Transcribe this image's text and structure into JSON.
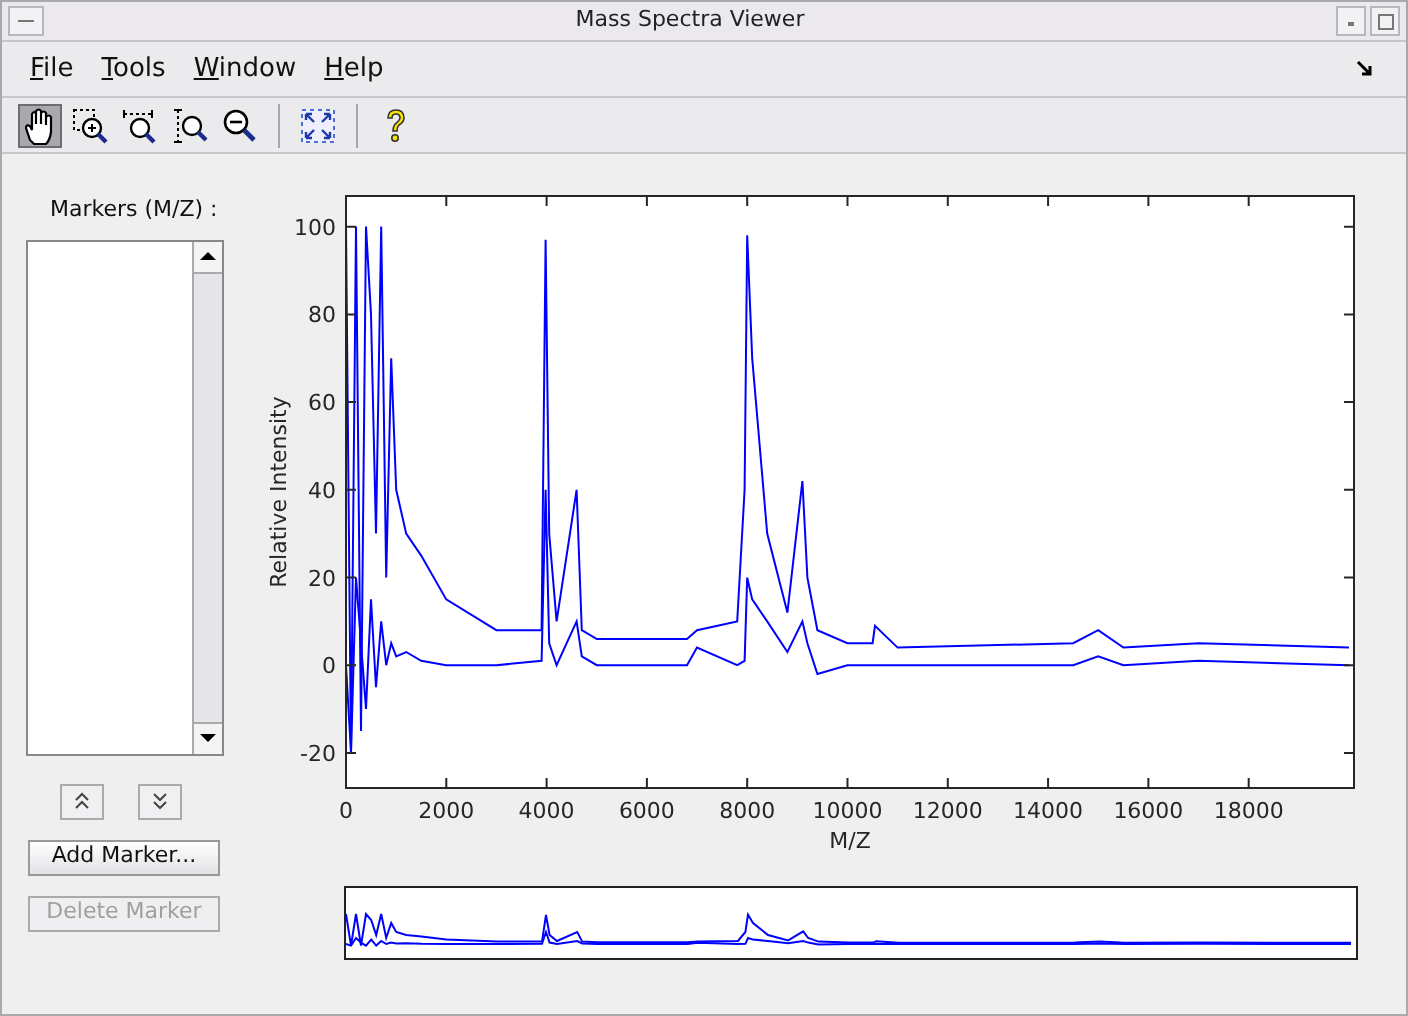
{
  "window": {
    "title": "Mass Spectra Viewer"
  },
  "menu": [
    {
      "label": "File"
    },
    {
      "label": "Tools"
    },
    {
      "label": "Window"
    },
    {
      "label": "Help"
    }
  ],
  "toolbar": [
    {
      "kind": "pan",
      "selected": true
    },
    {
      "kind": "zoom-xy",
      "selected": false
    },
    {
      "kind": "zoom-x",
      "selected": false
    },
    {
      "kind": "zoom-y",
      "selected": false
    },
    {
      "kind": "zoom-out",
      "selected": false
    },
    {
      "kind": "separator"
    },
    {
      "kind": "reset-view",
      "selected": false
    },
    {
      "kind": "separator"
    },
    {
      "kind": "help",
      "selected": false
    }
  ],
  "markers_panel": {
    "label": "Markers (M/Z) :",
    "buttons": [
      {
        "label": "Add Marker...",
        "disabled": false
      },
      {
        "label": "Delete Marker",
        "disabled": true
      }
    ]
  },
  "plot": {
    "chart_data": {
      "type": "line",
      "xlabel": "M/Z",
      "ylabel": "Relative Intensity",
      "xlim": [
        0,
        20100
      ],
      "ylim": [
        -28,
        107
      ],
      "xticks": [
        0,
        2000,
        4000,
        6000,
        8000,
        10000,
        12000,
        14000,
        16000,
        18000
      ],
      "yticks": [
        -20,
        0,
        20,
        40,
        60,
        80,
        100
      ],
      "x": [
        0,
        100,
        200,
        300,
        400,
        500,
        600,
        700,
        800,
        900,
        1000,
        1200,
        1500,
        2000,
        3000,
        3900,
        3980,
        4050,
        4200,
        4600,
        4700,
        5000,
        5500,
        6800,
        7000,
        7800,
        7950,
        8000,
        8100,
        8400,
        8800,
        9100,
        9200,
        9400,
        10000,
        10500,
        10550,
        11000,
        14500,
        15000,
        15500,
        17000,
        20000
      ],
      "series": [
        {
          "color": "#0000ff",
          "values": [
            100,
            -20,
            100,
            -15,
            100,
            80,
            30,
            100,
            20,
            70,
            40,
            30,
            25,
            15,
            8,
            8,
            97,
            30,
            10,
            40,
            8,
            6,
            6,
            6,
            8,
            10,
            40,
            98,
            70,
            30,
            12,
            42,
            20,
            8,
            5,
            5,
            9,
            4,
            5,
            8,
            4,
            5,
            4
          ]
        },
        {
          "color": "#0000ff",
          "values": [
            0,
            -20,
            20,
            5,
            -10,
            15,
            -5,
            10,
            0,
            5,
            2,
            3,
            1,
            0,
            0,
            1,
            40,
            5,
            0,
            10,
            2,
            0,
            0,
            0,
            4,
            0,
            1,
            20,
            15,
            10,
            3,
            10,
            5,
            -2,
            0,
            0,
            0,
            0,
            0,
            2,
            0,
            1,
            0
          ]
        }
      ]
    }
  }
}
